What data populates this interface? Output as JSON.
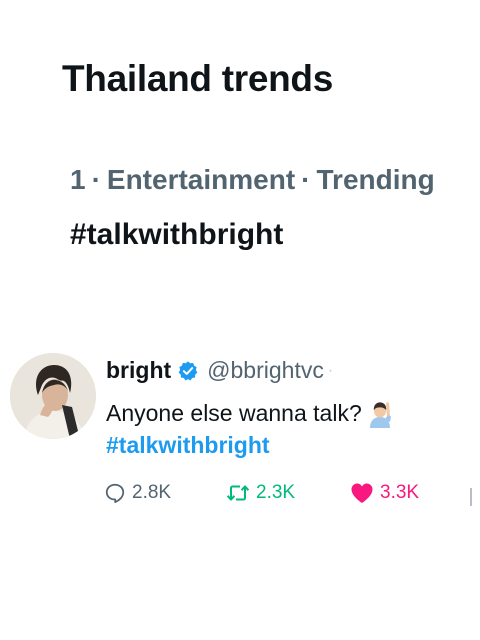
{
  "section": {
    "title": "Thailand trends"
  },
  "trend": {
    "rank": "1",
    "category": "Entertainment",
    "status": "Trending",
    "name": "#talkwithbright"
  },
  "tweet": {
    "display_name": "bright",
    "handle": "@bbrightvc",
    "text": "Anyone else wanna talk?",
    "hashtag": "#talkwithbright",
    "verified": true,
    "emoji": "person-raising-hand",
    "stats": {
      "replies": "2.8K",
      "reposts": "2.3K",
      "likes": "3.3K"
    }
  },
  "colors": {
    "link": "#1d9bf0",
    "repost": "#00ba7c",
    "like": "#f91880",
    "muted": "#536471",
    "text": "#0f1419"
  }
}
